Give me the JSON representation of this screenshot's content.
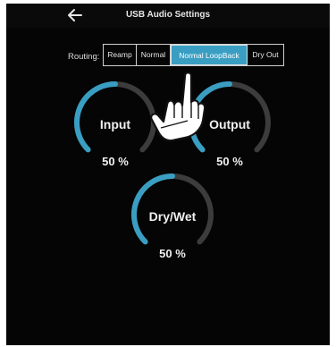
{
  "header": {
    "title": "USB Audio Settings",
    "back_icon": "arrow-left-icon"
  },
  "routing": {
    "label": "Routing:",
    "options": [
      "Reamp",
      "Normal",
      "Normal LoopBack",
      "Dry Out"
    ],
    "selected": "Normal LoopBack"
  },
  "knobs": {
    "input": {
      "label": "Input",
      "value": "50 %",
      "level": 0.5
    },
    "output": {
      "label": "Output",
      "value": "50 %",
      "level": 0.5
    },
    "drywet": {
      "label": "Dry/Wet",
      "value": "50 %",
      "level": 0.5
    }
  },
  "overlay": {
    "icon": "pointing-hand-icon"
  },
  "colors": {
    "accent": "#3a9ec2",
    "track": "#3c3c3c",
    "background": "#050505"
  }
}
